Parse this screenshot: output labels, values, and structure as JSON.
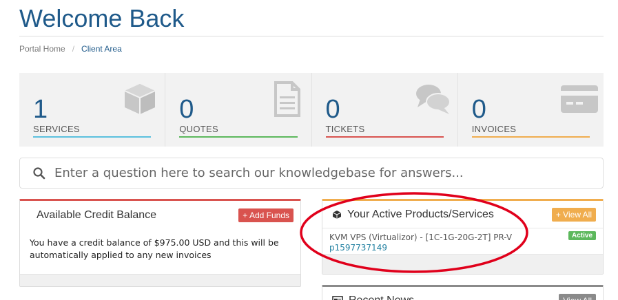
{
  "page": {
    "title": "Welcome Back"
  },
  "breadcrumb": {
    "home": "Portal Home",
    "separator": "/",
    "current": "Client Area"
  },
  "stats": [
    {
      "count": "1",
      "label": "SERVICES",
      "color": "#5bc0de",
      "icon": "cube-icon"
    },
    {
      "count": "0",
      "label": "QUOTES",
      "color": "#5cb85c",
      "icon": "document-icon"
    },
    {
      "count": "0",
      "label": "TICKETS",
      "color": "#d9534f",
      "icon": "chat-bubbles-icon"
    },
    {
      "count": "0",
      "label": "INVOICES",
      "color": "#f0ad4e",
      "icon": "credit-card-icon"
    }
  ],
  "search": {
    "placeholder": "Enter a question here to search our knowledgebase for answers..."
  },
  "credit_panel": {
    "title": "Available Credit Balance",
    "button": "+ Add Funds",
    "body": "You have a credit balance of $975.00 USD and this will be automatically applied to any new invoices"
  },
  "products_panel": {
    "title": "Your Active Products/Services",
    "button": "+ View All",
    "items": [
      {
        "name": "KVM VPS (Virtualizor) - [1C-1G-20G-2T] PR-V",
        "domain": "p1597737149",
        "status": "Active"
      }
    ]
  },
  "news_panel": {
    "title": "Recent News",
    "button": "View All"
  },
  "colors": {
    "brand": "#1f5a8a",
    "annotation": "#e0001b"
  }
}
